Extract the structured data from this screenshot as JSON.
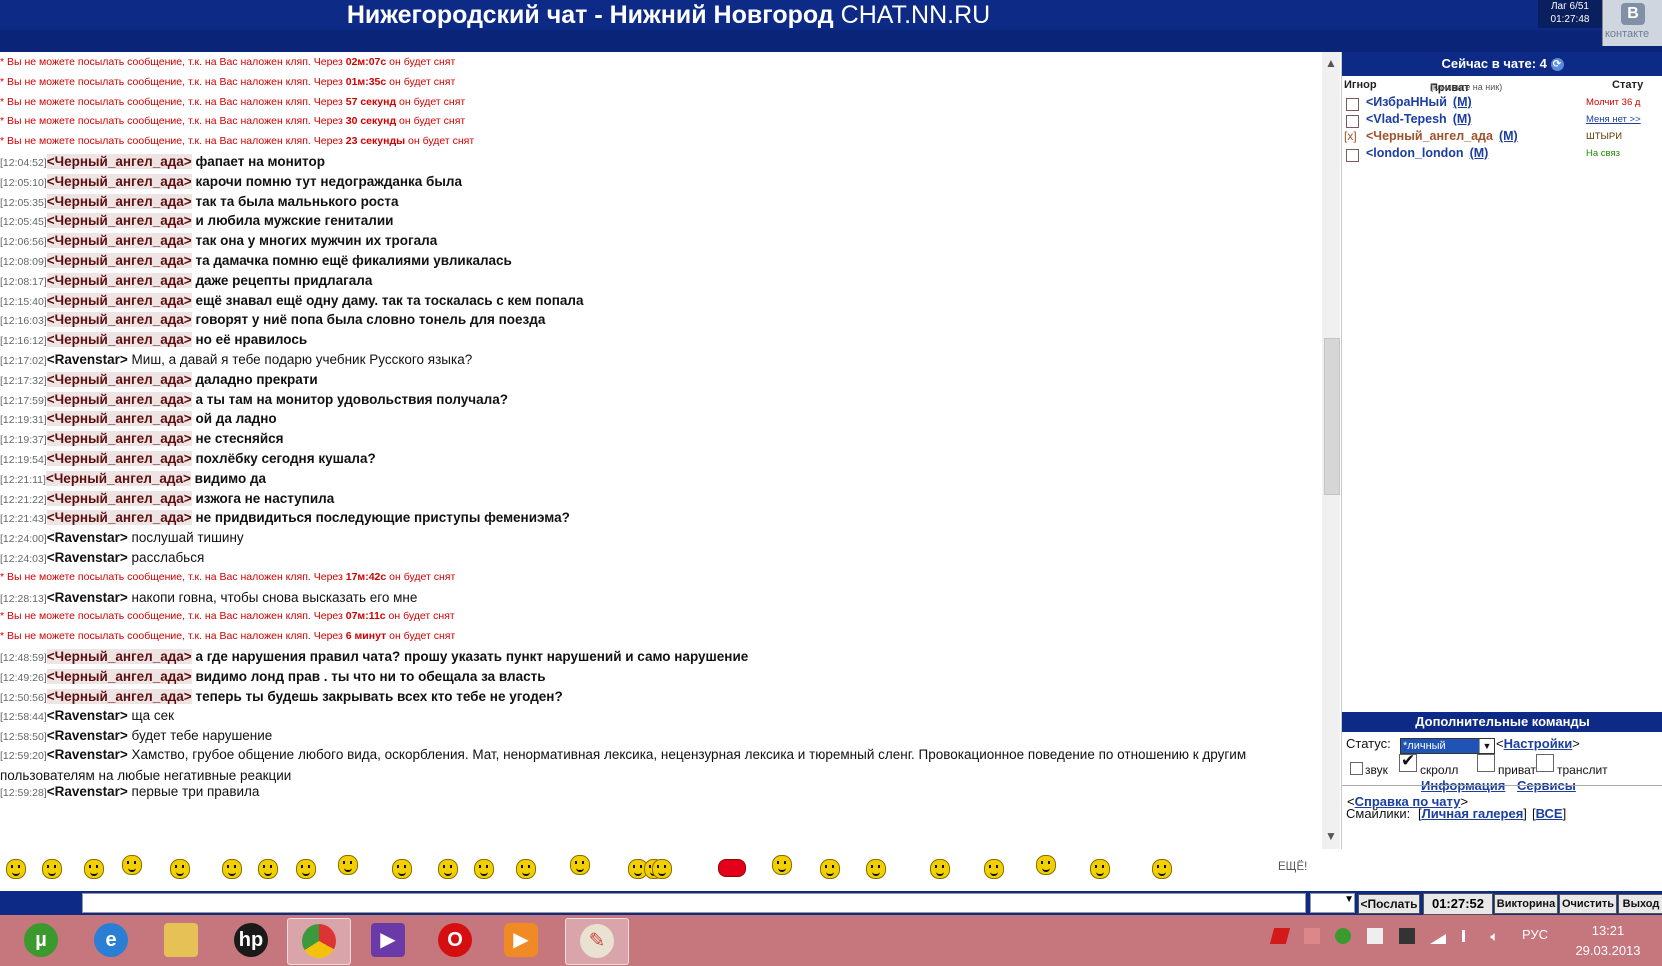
{
  "header": {
    "title": "Нижегородский чат - Нижний Новгород",
    "site": "CHAT.NN.RU",
    "lag": "Лаг 6/51",
    "lag_time": "01:27:48",
    "vk_letter": "В",
    "vk_label": "контакте"
  },
  "messages": [
    {
      "type": "sys",
      "pre": "* Вы не можете посылать сообщение, т.к. на Вас наложен кляп. Через ",
      "hl": "02м:07с",
      "post": " он будет снят"
    },
    {
      "type": "sys",
      "pre": "* Вы не можете посылать сообщение, т.к. на Вас наложен кляп. Через ",
      "hl": "01м:35с",
      "post": " он будет снят"
    },
    {
      "type": "sys",
      "pre": "* Вы не можете посылать сообщение, т.к. на Вас наложен кляп. Через ",
      "hl": "57 секунд",
      "post": " он будет снят"
    },
    {
      "type": "sys",
      "pre": "* Вы не можете посылать сообщение, т.к. на Вас наложен кляп. Через ",
      "hl": "30 секунд",
      "post": " он будет снят"
    },
    {
      "type": "sys",
      "pre": "* Вы не можете посылать сообщение, т.к. на Вас наложен кляп. Через ",
      "hl": "23 секунды",
      "post": " он будет снят"
    },
    {
      "type": "red",
      "ts": "[12:04:52]",
      "nick": "<Черный_ангел_ада>",
      "text": "фапает на монитор"
    },
    {
      "type": "red",
      "ts": "[12:05:10]",
      "nick": "<Черный_ангел_ада>",
      "text": "карочи помню тут недогражданка была"
    },
    {
      "type": "red",
      "ts": "[12:05:35]",
      "nick": "<Черный_ангел_ада>",
      "text": "так та была мальнького роста"
    },
    {
      "type": "red",
      "ts": "[12:05:45]",
      "nick": "<Черный_ангел_ада>",
      "text": "и любила мужские гениталии"
    },
    {
      "type": "red",
      "ts": "[12:06:56]",
      "nick": "<Черный_ангел_ада>",
      "text": "так она у многих мужчин их трогала"
    },
    {
      "type": "red",
      "ts": "[12:08:09]",
      "nick": "<Черный_ангел_ада>",
      "text": "та дамачка помню ещё фикалиями увликалась"
    },
    {
      "type": "red",
      "ts": "[12:08:17]",
      "nick": "<Черный_ангел_ада>",
      "text": "даже рецепты придлагала"
    },
    {
      "type": "red",
      "ts": "[12:15:40]",
      "nick": "<Черный_ангел_ада>",
      "text": "ещё знавал ещё одну даму. так та тоскалась с кем попала"
    },
    {
      "type": "red",
      "ts": "[12:16:03]",
      "nick": "<Черный_ангел_ада>",
      "text": "говорят у ниё попа была словно тонель для поезда"
    },
    {
      "type": "red",
      "ts": "[12:16:12]",
      "nick": "<Черный_ангел_ада>",
      "text": "но её нравилось"
    },
    {
      "type": "plain",
      "ts": "[12:17:02]",
      "nick": "<Ravenstar>",
      "text": "Миш, а давай я тебе подарю учебник Русского языка?"
    },
    {
      "type": "red",
      "ts": "[12:17:32]",
      "nick": "<Черный_ангел_ада>",
      "text": "даладно прекрати"
    },
    {
      "type": "red",
      "ts": "[12:17:59]",
      "nick": "<Черный_ангел_ада>",
      "text": "а ты там на монитор удовольствия получала?"
    },
    {
      "type": "red",
      "ts": "[12:19:31]",
      "nick": "<Черный_ангел_ада>",
      "text": "ой да ладно"
    },
    {
      "type": "red",
      "ts": "[12:19:37]",
      "nick": "<Черный_ангел_ада>",
      "text": "не стесняйся"
    },
    {
      "type": "red",
      "ts": "[12:19:54]",
      "nick": "<Черный_ангел_ада>",
      "text": "похлёбку сегодня кушала?"
    },
    {
      "type": "red",
      "ts": "[12:21:11]",
      "nick": "<Черный_ангел_ада>",
      "text": "видимо да"
    },
    {
      "type": "red",
      "ts": "[12:21:22]",
      "nick": "<Черный_ангел_ада>",
      "text": "изжога не наступила"
    },
    {
      "type": "red",
      "ts": "[12:21:43]",
      "nick": "<Черный_ангел_ада>",
      "text": "не придвидиться последующие приступы фемениэма?"
    },
    {
      "type": "plain",
      "ts": "[12:24:00]",
      "nick": "<Ravenstar>",
      "text": "послушай тишину"
    },
    {
      "type": "plain",
      "ts": "[12:24:03]",
      "nick": "<Ravenstar>",
      "text": "расслабься"
    },
    {
      "type": "sys",
      "pre": "* Вы не можете посылать сообщение, т.к. на Вас наложен кляп. Через ",
      "hl": "17м:42с",
      "post": " он будет снят"
    },
    {
      "type": "plain",
      "ts": "[12:28:13]",
      "nick": "<Ravenstar>",
      "text": "накопи говна, чтобы снова высказать его мне"
    },
    {
      "type": "sys",
      "pre": "* Вы не можете посылать сообщение, т.к. на Вас наложен кляп. Через ",
      "hl": "07м:11с",
      "post": " он будет снят"
    },
    {
      "type": "sys",
      "pre": "* Вы не можете посылать сообщение, т.к. на Вас наложен кляп. Через ",
      "hl": "6 минут",
      "post": " он будет снят"
    },
    {
      "type": "red",
      "ts": "[12:48:59]",
      "nick": "<Черный_ангел_ада>",
      "text": "а где нарушения правил чата? прошу указать пункт нарушений и само нарушение"
    },
    {
      "type": "red",
      "ts": "[12:49:26]",
      "nick": "<Черный_ангел_ада>",
      "text": "видимо лонд прав . ты что ни то обещала за власть"
    },
    {
      "type": "red",
      "ts": "[12:50:56]",
      "nick": "<Черный_ангел_ада>",
      "text": "теперь ты будешь закрывать всех кто тебе не угоден?"
    },
    {
      "type": "plain",
      "ts": "[12:58:44]",
      "nick": "<Ravenstar>",
      "text": "ща сек"
    },
    {
      "type": "plain",
      "ts": "[12:58:50]",
      "nick": "<Ravenstar>",
      "text": "будет тебе нарушение"
    },
    {
      "type": "plain",
      "ts": "[12:59:20]",
      "nick": "<Ravenstar>",
      "text": "Хамство, грубое общение любого вида, оскорбления. Мат, ненормативная лексика, нецензурная лексика и тюремный сленг. Провокационное поведение по отношению к другим пользователям на любые негативные реакции",
      "wrap": true
    },
    {
      "type": "plain",
      "ts": "[12:59:28]",
      "nick": "<Ravenstar>",
      "text": "первые три правила"
    }
  ],
  "online": {
    "title": "Сейчас в чате: 4",
    "col_ignore": "Игнор",
    "col_private": "Приват",
    "col_private_hint": "(кликните на ник)",
    "col_status": "Стату",
    "users": [
      {
        "mark": "",
        "name": "<ИзбраННый",
        "m": "(М)",
        "status": "Молчит 36 д",
        "color": "#1b3ea0",
        "scolor": "#d40000",
        "sunder": false
      },
      {
        "mark": "",
        "name": "<Vlad-Tepesh",
        "m": "(М)",
        "status": "Меня нет >>",
        "color": "#1b3ea0",
        "scolor": "#1b3ea0",
        "sunder": true
      },
      {
        "mark": "[x]",
        "name": "<Черный_ангел_ада",
        "m": "(М)",
        "status": "ШТЫРИ",
        "color": "#a0522d",
        "scolor": "#5a3a00",
        "sunder": false
      },
      {
        "mark": "",
        "name": "<london_london",
        "m": "(М)",
        "status": "На связ",
        "color": "#1b3ea0",
        "scolor": "#1a8f00",
        "sunder": false
      }
    ]
  },
  "extra": {
    "title": "Дополнительные команды",
    "status_label": "Статус:",
    "status_value": "*личный",
    "settings_link": "Настройки",
    "cb_sound": "звук",
    "cb_scroll": "скролл",
    "cb_private": "приват",
    "cb_translit": "транслит",
    "info_link": "Информация",
    "services_link": "Сервисы",
    "smileys_label": "Смайлики:",
    "gallery_link": "Личная галерея",
    "all_link": "ВСЕ",
    "help_link": "Справка по чату"
  },
  "smileys_more": "ЕЩЁ!",
  "input": {
    "send": "Послать",
    "time": "01:27:52",
    "quiz": "Викторина",
    "clear": "Очистить",
    "exit": "Выход"
  },
  "taskbar": {
    "lang": "РУС",
    "time": "13:21",
    "date": "29.03.2013"
  },
  "colors": {
    "brand_blue": "#0c2a86",
    "system_red": "#d40000",
    "taskbar": "#c6767d"
  }
}
